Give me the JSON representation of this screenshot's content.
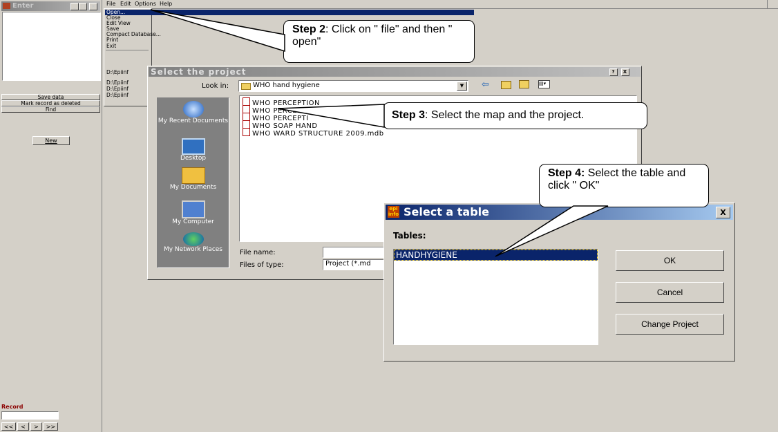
{
  "enter_window": {
    "title": "Enter",
    "buttons": {
      "save": "Save data",
      "mark_deleted": "Mark record as deleted",
      "find": "Find",
      "new": "New"
    },
    "record_label": "Record",
    "nav": [
      "<<",
      "<",
      ">",
      ">>"
    ]
  },
  "menubar": {
    "items": [
      "File",
      "Edit",
      "Options",
      "Help"
    ]
  },
  "file_menu": {
    "items": [
      "Open...",
      "Close",
      "Edit View",
      "Save",
      "Compact Database...",
      "Print",
      "Exit"
    ],
    "recent": [
      "D:\\Epiinf",
      "D:\\Epiinf",
      "D:\\Epiinf",
      "D:\\Epiinf"
    ]
  },
  "project_dialog": {
    "title": "Select the project",
    "title_buttons": [
      "?",
      "X"
    ],
    "look_in_label": "Look in:",
    "look_in_value": "WHO hand hygiene",
    "places": [
      "My Recent Documents",
      "Desktop",
      "My Documents",
      "My Computer",
      "My Network Places"
    ],
    "files": [
      "WHO PERCEPTION",
      "WHO PERCEPTI",
      "WHO PERCEPTI",
      "WHO SOAP HAND",
      "WHO WARD STRUCTURE 2009.mdb"
    ],
    "file_name_label": "File name:",
    "file_name_value": "",
    "files_of_type_label": "Files of type:",
    "files_of_type_value": "Project (*.md"
  },
  "table_dialog": {
    "logo": "epi info",
    "title": "Select a table",
    "close": "X",
    "tables_label": "Tables:",
    "tables": [
      "HANDHYGIENE"
    ],
    "ok": "OK",
    "cancel": "Cancel",
    "change_project": "Change Project"
  },
  "callouts": {
    "step2_bold": "Step 2",
    "step2_text": ": Click on \" file\" and then \" open\"",
    "step3_bold": "Step 3",
    "step3_text": ": Select the map and the project.",
    "step4_bold": "Step 4:",
    "step4_text": " Select the table and click \" OK\""
  }
}
